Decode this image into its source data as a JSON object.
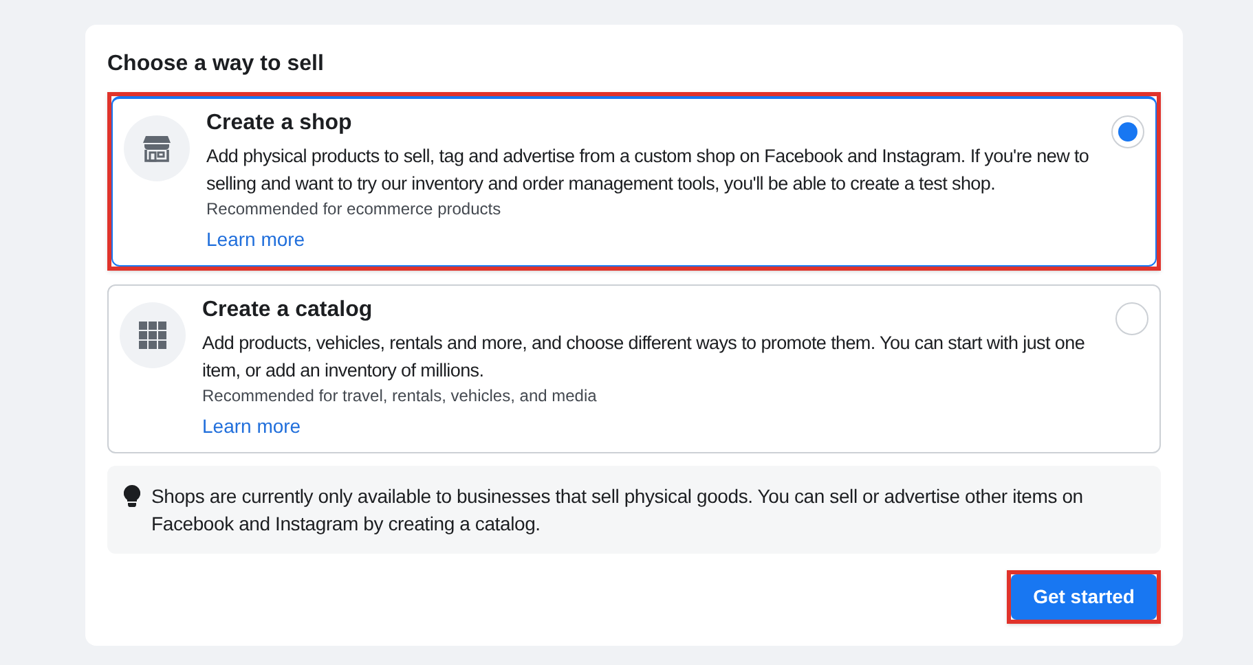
{
  "heading": "Choose a way to sell",
  "options": [
    {
      "kind": "shop",
      "title": "Create a shop",
      "description": "Add physical products to sell, tag and advertise from a custom shop on Facebook and Instagram. If you're new to selling and want to try our inventory and order management tools, you'll be able to create a test shop.",
      "note": "Recommended for ecommerce products",
      "link": "Learn more",
      "selected": true,
      "highlighted": true
    },
    {
      "kind": "grid",
      "title": "Create a catalog",
      "description": "Add products, vehicles, rentals and more, and choose different ways to promote them. You can start with just one item, or add an inventory of millions.",
      "note": "Recommended for travel, rentals, vehicles, and media",
      "link": "Learn more",
      "selected": false,
      "highlighted": false
    }
  ],
  "notice": "Shops are currently only available to businesses that sell physical goods. You can sell or advertise other items on Facebook and Instagram by creating a catalog.",
  "button": {
    "label": "Get started",
    "highlighted": true
  }
}
